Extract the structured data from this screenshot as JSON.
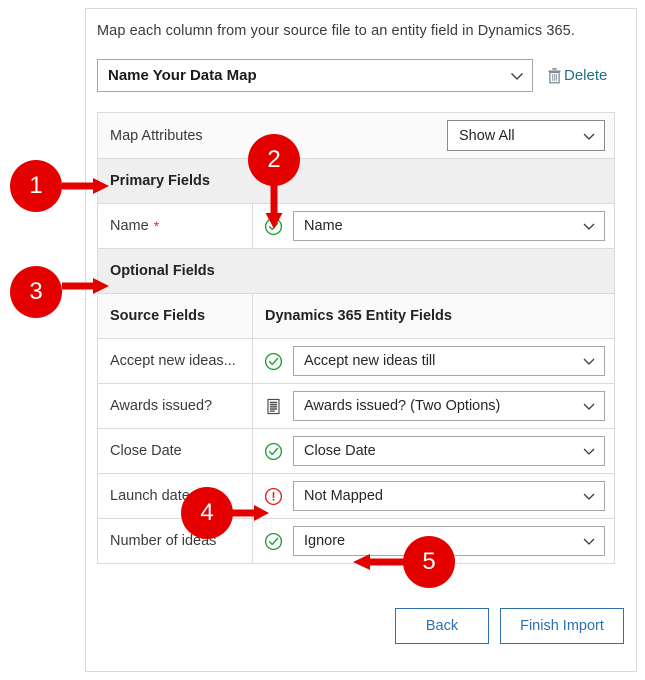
{
  "dialog": {
    "intro": "Map each column from your source file to an entity field in Dynamics 365.",
    "map_name": {
      "value": "Name Your Data Map",
      "chevron_icon": "chevron-down-icon"
    },
    "delete": {
      "label": "Delete",
      "icon": "trash-icon"
    }
  },
  "table": {
    "map_attributes_label": "Map Attributes",
    "show_all": {
      "value": "Show All",
      "chevron_icon": "chevron-down-icon"
    },
    "primary_fields_header": "Primary Fields",
    "optional_fields_header": "Optional Fields",
    "column_headers": {
      "source": "Source Fields",
      "entity": "Dynamics 365 Entity Fields"
    },
    "primary_rows": [
      {
        "source": "Name",
        "required_marker": "*",
        "status_icon": "check-circle-icon",
        "status": "mapped",
        "mapping": "Name"
      }
    ],
    "optional_rows": [
      {
        "source": "Accept new ideas...",
        "status_icon": "check-circle-icon",
        "status": "mapped",
        "mapping": "Accept new ideas till"
      },
      {
        "source": "Awards issued?",
        "status_icon": "list-document-icon",
        "status": "option-set",
        "mapping": "Awards issued? (Two Options)"
      },
      {
        "source": "Close Date",
        "status_icon": "check-circle-icon",
        "status": "mapped",
        "mapping": "Close Date"
      },
      {
        "source": "Launch date",
        "status_icon": "error-circle-icon",
        "status": "error",
        "mapping": "Not Mapped"
      },
      {
        "source": "Number of ideas",
        "status_icon": "check-circle-icon",
        "status": "mapped",
        "mapping": "Ignore"
      }
    ]
  },
  "footer": {
    "back_label": "Back",
    "finish_label": "Finish Import"
  },
  "callouts": [
    {
      "number": "1",
      "direction": "right",
      "target": "primary-fields-header"
    },
    {
      "number": "2",
      "direction": "down",
      "target": "name-row-status-icon"
    },
    {
      "number": "3",
      "direction": "right",
      "target": "optional-fields-header"
    },
    {
      "number": "4",
      "direction": "right",
      "target": "launch-date-status-icon"
    },
    {
      "number": "5",
      "direction": "left",
      "target": "number-of-ideas-mapping"
    }
  ],
  "colors": {
    "callout_red": "#e50000",
    "link_blue": "#1f6f8b",
    "button_blue": "#2f6fad",
    "status_green": "#1a9b2e",
    "status_red": "#e11d1d",
    "required_star": "#d92c2c"
  }
}
